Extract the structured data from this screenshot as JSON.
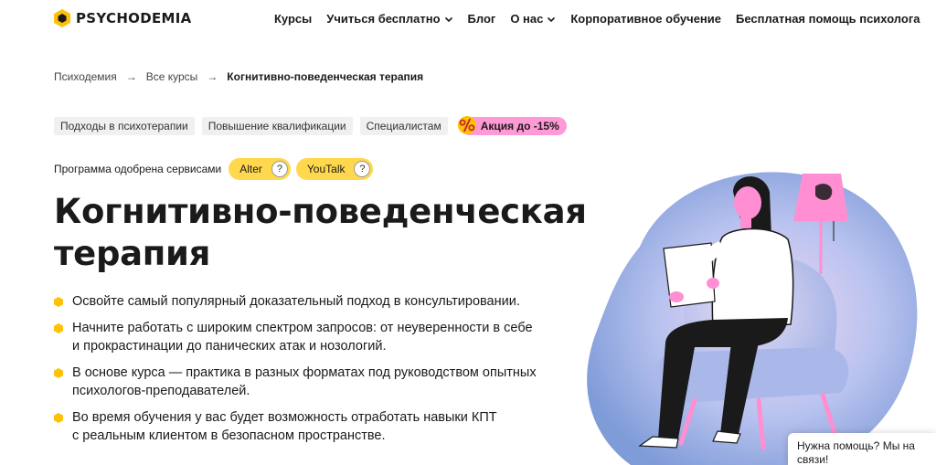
{
  "header": {
    "logo_text": "PSYCHODEMIA",
    "nav": [
      {
        "label": "Курсы",
        "dropdown": false
      },
      {
        "label": "Учиться бесплатно",
        "dropdown": true
      },
      {
        "label": "Блог",
        "dropdown": false
      },
      {
        "label": "О нас",
        "dropdown": true
      },
      {
        "label": "Корпоративное обучение",
        "dropdown": false
      },
      {
        "label": "Бесплатная помощь психолога",
        "dropdown": false
      }
    ]
  },
  "breadcrumb": {
    "items": [
      "Психодемия",
      "Все курсы"
    ],
    "current": "Когнитивно-поведенческая терапия",
    "separator": "→"
  },
  "tags": [
    "Подходы в психотерапии",
    "Повышение квалификации",
    "Специалистам"
  ],
  "promo": {
    "label": "Акция до -15%",
    "icon": "percent-icon",
    "color": "#ff9ad6"
  },
  "approved": {
    "text": "Программа одобрена сервисами",
    "services": [
      {
        "label": "Alter",
        "help": "?"
      },
      {
        "label": "YouTalk",
        "help": "?"
      }
    ]
  },
  "title_lines": [
    "Когнитивно-поведенческая",
    "терапия"
  ],
  "bullets": [
    [
      "Освойте самый популярный доказательный подход в консультировании."
    ],
    [
      "Начните работать с широким спектром запросов: от неуверенности в себе",
      "и прокрастинации до панических атак и нозологий."
    ],
    [
      "В основе курса — практика в разных форматах под руководством опытных",
      "психологов-преподавателей."
    ],
    [
      "Во время обучения у вас будет возможность отработать навыки КПТ",
      "с реальным клиентом в безопасном пространстве."
    ]
  ],
  "chat": {
    "lines": [
      "Нужна помощь? Мы на",
      "связи!"
    ]
  },
  "colors": {
    "accent_yellow": "#ffd84d",
    "accent_pink": "#ff9ad6",
    "text": "#1a1a1a",
    "blob_blue": "#8fa8dc"
  }
}
